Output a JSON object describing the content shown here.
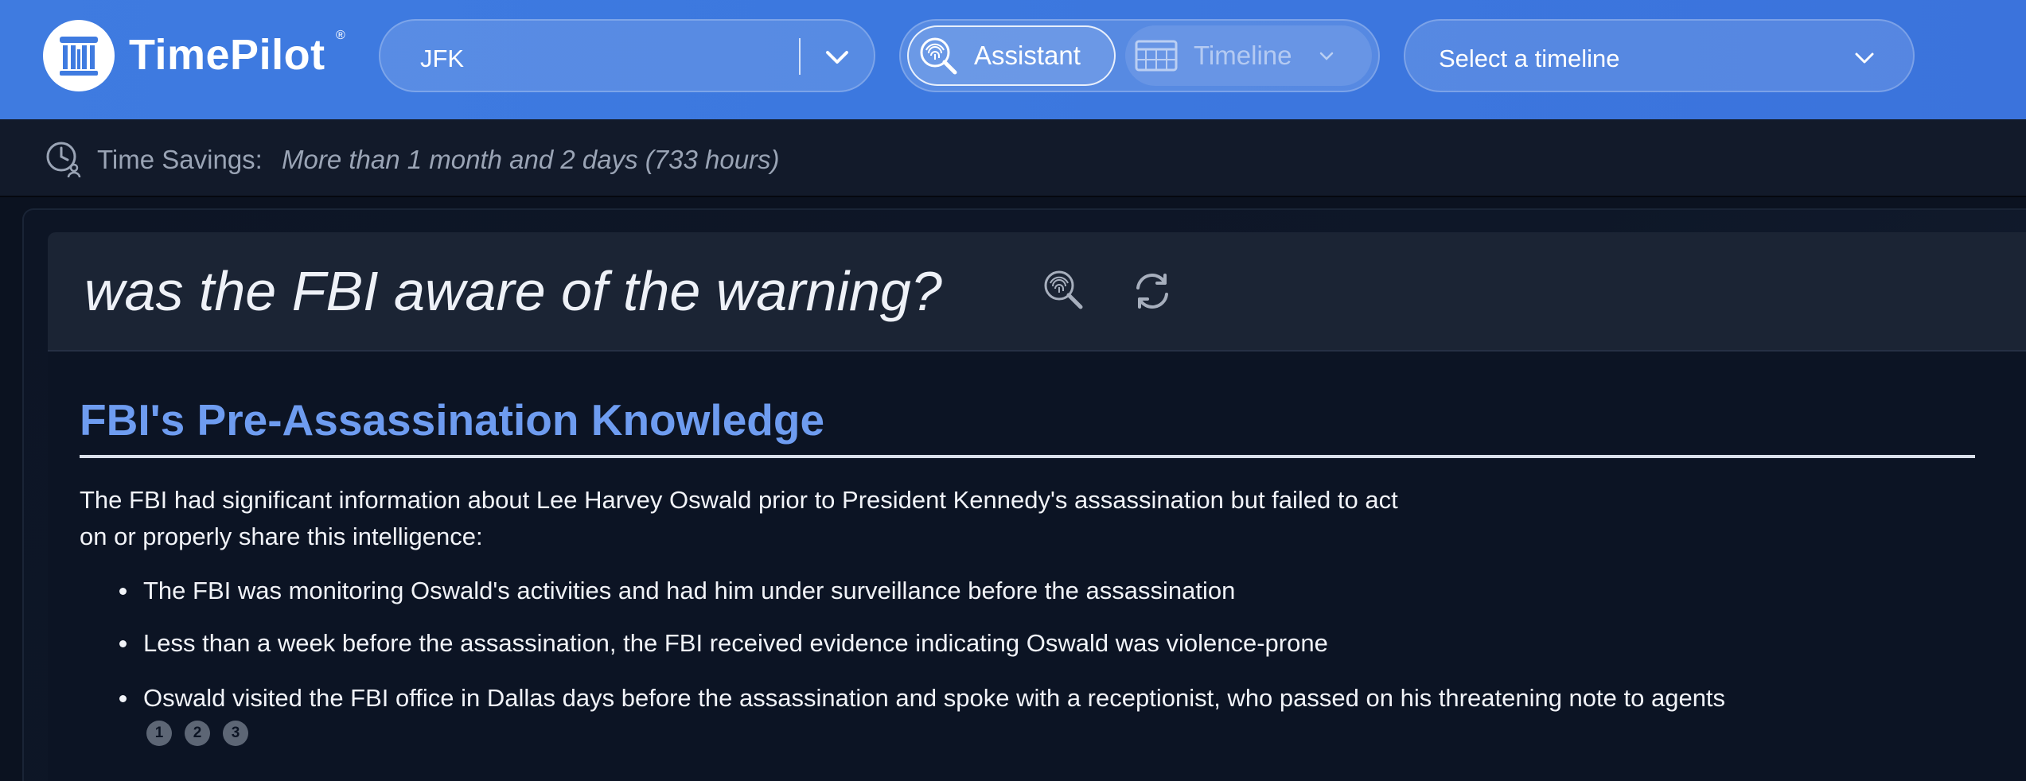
{
  "header": {
    "brand": "TimePilot",
    "brand_mark": "®",
    "project_select": {
      "value": "JFK"
    },
    "modes": [
      {
        "label": "Assistant",
        "active": true,
        "icon": "fingerprint-search-icon"
      },
      {
        "label": "Timeline",
        "active": false,
        "icon": "calendar-grid-icon"
      }
    ],
    "timeline_select": {
      "value": "Select a timeline"
    }
  },
  "savings": {
    "label": "Time Savings:",
    "value": "More than 1 month and 2 days (733 hours)"
  },
  "question": {
    "text": "was the FBI aware of the warning?"
  },
  "answer": {
    "title": "FBI's Pre-Assassination Knowledge",
    "intro_line1": "The FBI had significant information about Lee Harvey Oswald prior to President Kennedy's assassination but failed to act",
    "intro_line2": "on or properly share this intelligence:",
    "bullets": [
      "The FBI was monitoring Oswald's activities and had him under surveillance before the assassination",
      "Less than a week before the assassination, the FBI received evidence indicating Oswald was violence-prone",
      "Oswald visited the FBI office in Dallas days before the assassination and spoke with a receptionist, who passed on his threatening note to agents"
    ],
    "citations": [
      "1",
      "2",
      "3"
    ]
  },
  "colors": {
    "header_blue": "#3f7be0",
    "title_blue": "#6e9cf0",
    "background": "#0b1220"
  }
}
